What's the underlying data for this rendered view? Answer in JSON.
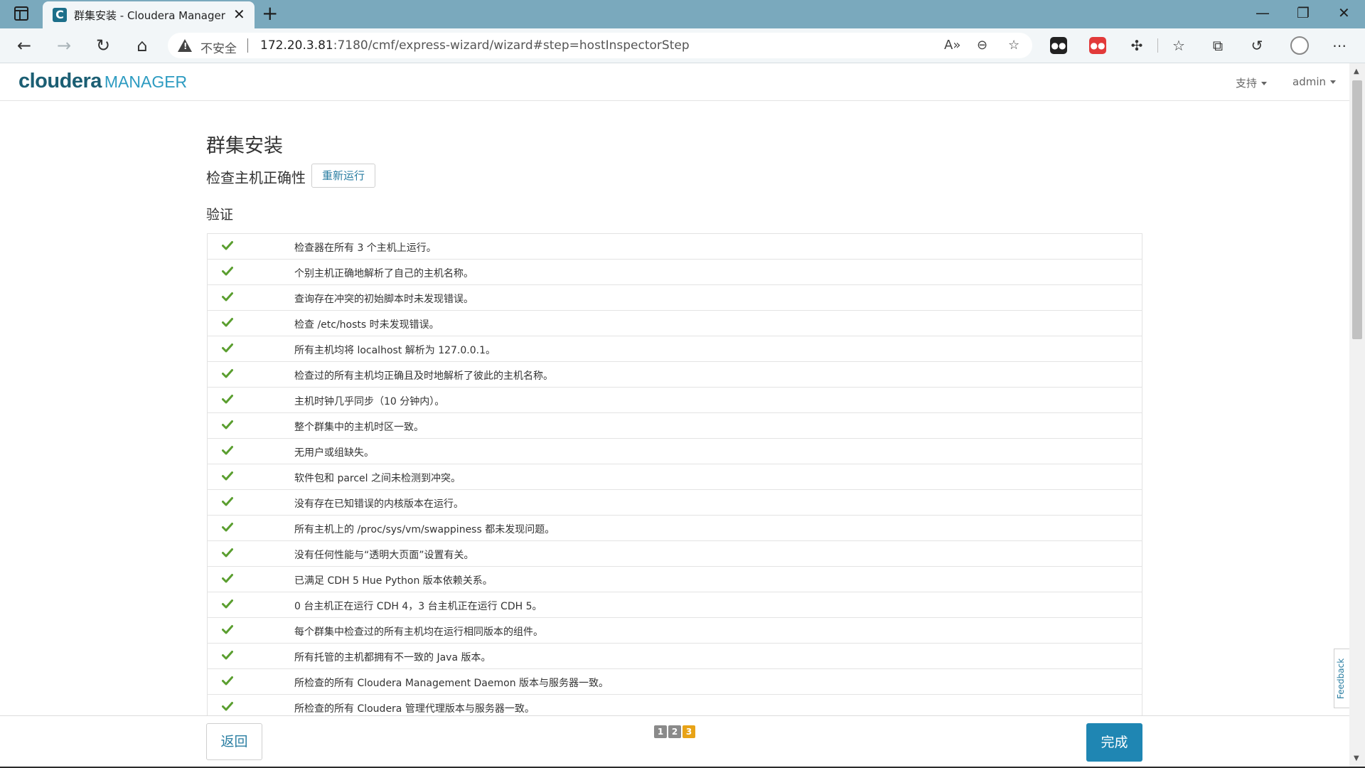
{
  "browser": {
    "tab_title": "群集安装 - Cloudera Manager",
    "tab_favicon_letter": "C",
    "security_label": "不安全",
    "url_host": "172.20.3.81",
    "url_rest": ":7180/cmf/express-wizard/wizard#step=hostInspectorStep"
  },
  "header": {
    "logo_main": "cloudera",
    "logo_sub": "MANAGER",
    "support_menu": "支持",
    "user_menu": "admin"
  },
  "page": {
    "title": "群集安装",
    "subtitle": "检查主机正确性",
    "rerun_button": "重新运行",
    "section": "验证"
  },
  "checks": [
    {
      "status": "pass",
      "text": "检查器在所有 3 个主机上运行。"
    },
    {
      "status": "pass",
      "text": "个别主机正确地解析了自己的主机名称。"
    },
    {
      "status": "pass",
      "text": "查询存在冲突的初始脚本时未发现错误。"
    },
    {
      "status": "pass",
      "text": "检查 /etc/hosts 时未发现错误。"
    },
    {
      "status": "pass",
      "text": "所有主机均将 localhost 解析为 127.0.0.1。"
    },
    {
      "status": "pass",
      "text": "检查过的所有主机均正确且及时地解析了彼此的主机名称。"
    },
    {
      "status": "pass",
      "text": "主机时钟几乎同步（10 分钟内）。"
    },
    {
      "status": "pass",
      "text": "整个群集中的主机时区一致。"
    },
    {
      "status": "pass",
      "text": "无用户或组缺失。"
    },
    {
      "status": "pass",
      "text": "软件包和 parcel 之间未检测到冲突。"
    },
    {
      "status": "pass",
      "text": "没有存在已知错误的内核版本在运行。"
    },
    {
      "status": "pass",
      "text": "所有主机上的 /proc/sys/vm/swappiness 都未发现问题。"
    },
    {
      "status": "pass",
      "text": "没有任何性能与“透明大页面”设置有关。"
    },
    {
      "status": "pass",
      "text": "已满足 CDH 5 Hue Python 版本依赖关系。"
    },
    {
      "status": "pass",
      "text": "0 台主机正在运行 CDH 4，3 台主机正在运行 CDH 5。"
    },
    {
      "status": "pass",
      "text": "每个群集中检查过的所有主机均在运行相同版本的组件。"
    },
    {
      "status": "pass",
      "text": "所有托管的主机都拥有不一致的 Java 版本。"
    },
    {
      "status": "pass",
      "text": "所检查的所有 Cloudera Management Daemon 版本与服务器一致。"
    },
    {
      "status": "pass",
      "text": "所检查的所有 Cloudera 管理代理版本与服务器一致。"
    }
  ],
  "footer": {
    "back_button": "返回",
    "finish_button": "完成",
    "steps": [
      "1",
      "2",
      "3"
    ],
    "current_step": 3
  },
  "feedback_label": "Feedback",
  "colors": {
    "check_green": "#5a9e2f",
    "primary_button": "#1f86b3",
    "current_step": "#e8a317",
    "tabstrip": "#7aa9bd"
  }
}
